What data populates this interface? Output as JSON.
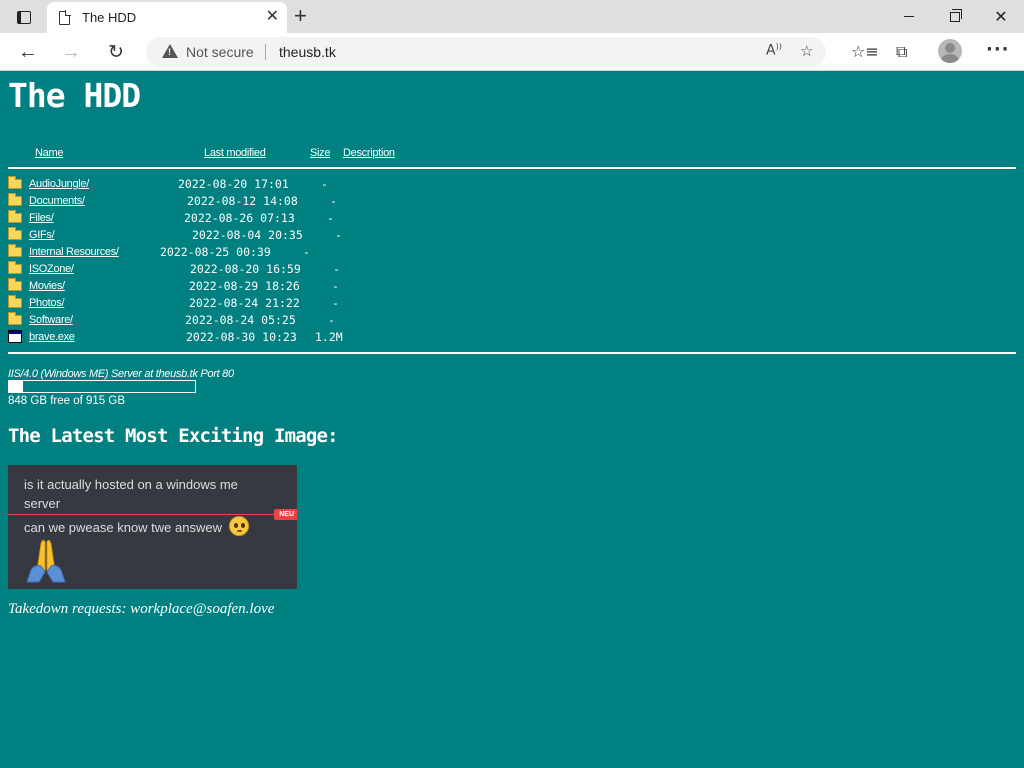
{
  "browser": {
    "tab_title": "The HDD",
    "security_label": "Not secure",
    "url": "theusb.tk"
  },
  "page": {
    "title": "The HDD",
    "columns": {
      "name": "Name",
      "last_modified": "Last modified",
      "size": "Size",
      "description": "Description"
    },
    "entries": [
      {
        "name": "AudioJungle/",
        "date": "2022-08-20 17:01",
        "size": "-",
        "type": "folder"
      },
      {
        "name": "Documents/",
        "date": "2022-08-12 14:08",
        "size": "-",
        "type": "folder"
      },
      {
        "name": "Files/",
        "date": "2022-08-26 07:13",
        "size": "-",
        "type": "folder"
      },
      {
        "name": "GIFs/",
        "date": "2022-08-04 20:35",
        "size": "-",
        "type": "folder"
      },
      {
        "name": "Internal Resources/",
        "date": "2022-08-25 00:39",
        "size": "-",
        "type": "folder"
      },
      {
        "name": "ISOZone/",
        "date": "2022-08-20 16:59",
        "size": "-",
        "type": "folder"
      },
      {
        "name": "Movies/",
        "date": "2022-08-29 18:26",
        "size": "-",
        "type": "folder"
      },
      {
        "name": "Photos/",
        "date": "2022-08-24 21:22",
        "size": "-",
        "type": "folder"
      },
      {
        "name": "Software/",
        "date": "2022-08-24 05:25",
        "size": "-",
        "type": "folder"
      },
      {
        "name": "brave.exe",
        "date": "2022-08-30 10:23",
        "size": "1.2M",
        "type": "file"
      }
    ],
    "server_signature": "IIS/4.0 (Windows ME) Server at theusb.tk Port 80",
    "disk": {
      "used_fraction": 0.073,
      "label": "848 GB free of 915 GB"
    },
    "latest_heading": "The Latest Most Exciting Image:",
    "image": {
      "message_1": "is it actually hosted on a windows me server",
      "message_2": "can we pwease know twe answew",
      "new_badge": "NEU"
    },
    "takedown": "Takedown requests: workplace@soafen.love"
  }
}
